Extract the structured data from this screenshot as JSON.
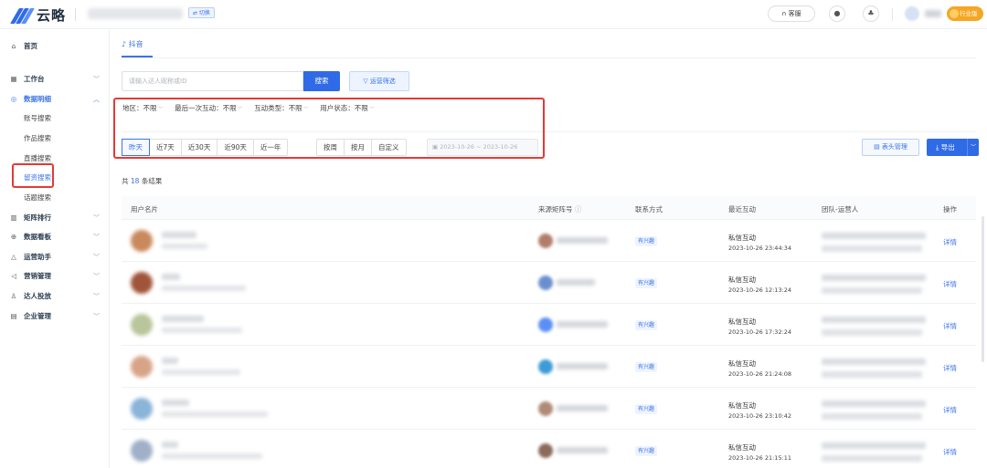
{
  "header": {
    "logo_text": "云略",
    "switch_label": "⇄ 切换",
    "service_label": "客服",
    "industry_label": "行业版",
    "brand_color": "#2f6be6",
    "badge_color": "#f5a623"
  },
  "sidebar": {
    "items": [
      {
        "icon": "home-icon",
        "glyph": "⌂",
        "label": "首页",
        "chevron": ""
      },
      {
        "icon": "workbench-icon",
        "glyph": "▦",
        "label": "工作台",
        "chevron": "﹀"
      },
      {
        "icon": "data-detail-icon",
        "glyph": "◎",
        "label": "数据明细",
        "chevron": "︿"
      },
      {
        "icon": "matrix-rank-icon",
        "glyph": "▥",
        "label": "矩阵排行",
        "chevron": "﹀"
      },
      {
        "icon": "dashboard-icon",
        "glyph": "⊕",
        "label": "数据看板",
        "chevron": "﹀"
      },
      {
        "icon": "ops-assistant-icon",
        "glyph": "△",
        "label": "运营助手",
        "chevron": "﹀"
      },
      {
        "icon": "marketing-icon",
        "glyph": "◁",
        "label": "营销管理",
        "chevron": "﹀"
      },
      {
        "icon": "talent-icon",
        "glyph": "♙",
        "label": "达人投放",
        "chevron": "﹀"
      },
      {
        "icon": "enterprise-icon",
        "glyph": "▤",
        "label": "企业管理",
        "chevron": "﹀"
      }
    ],
    "subitems": [
      "账号搜索",
      "作品搜索",
      "直播搜索",
      "留资搜索",
      "话题搜索"
    ]
  },
  "main": {
    "tab_label": "抖音",
    "search_placeholder": "请输入达人昵称或ID",
    "search_button": "搜索",
    "ops_filter_button": "运营筛选",
    "filters": [
      {
        "label": "地区：",
        "value": "不限"
      },
      {
        "label": "最后一次互动：",
        "value": "不限"
      },
      {
        "label": "互动类型：",
        "value": "不限"
      },
      {
        "label": "用户状态：",
        "value": "不限"
      }
    ],
    "day_ranges": [
      "昨天",
      "近7天",
      "近30天",
      "近90天",
      "近一年"
    ],
    "period_ranges": [
      "按周",
      "按月",
      "自定义"
    ],
    "date_range": "2023-10-26 ~ 2023-10-26",
    "column_manage_button": "表头管理",
    "export_button": "导出",
    "result_prefix": "共",
    "result_count": "18",
    "result_suffix": "条结果"
  },
  "table": {
    "columns": [
      "用户名片",
      "来源矩阵号",
      "联系方式",
      "最近互动",
      "团队-运营人",
      "操作"
    ],
    "rows": [
      {
        "contact": "有兴趣",
        "interaction": "私信互动",
        "time": "2023-10-26 23:44:34",
        "action": "详情"
      },
      {
        "contact": "有兴趣",
        "interaction": "私信互动",
        "time": "2023-10-26 12:13:24",
        "action": "详情"
      },
      {
        "contact": "有兴趣",
        "interaction": "私信互动",
        "time": "2023-10-26 17:32:24",
        "action": "详情"
      },
      {
        "contact": "有兴趣",
        "interaction": "私信互动",
        "time": "2023-10-26 21:24:08",
        "action": "详情"
      },
      {
        "contact": "有兴趣",
        "interaction": "私信互动",
        "time": "2023-10-26 23:10:42",
        "action": "详情"
      },
      {
        "contact": "有兴趣",
        "interaction": "私信互动",
        "time": "2023-10-26 21:15:11",
        "action": "详情"
      }
    ]
  }
}
